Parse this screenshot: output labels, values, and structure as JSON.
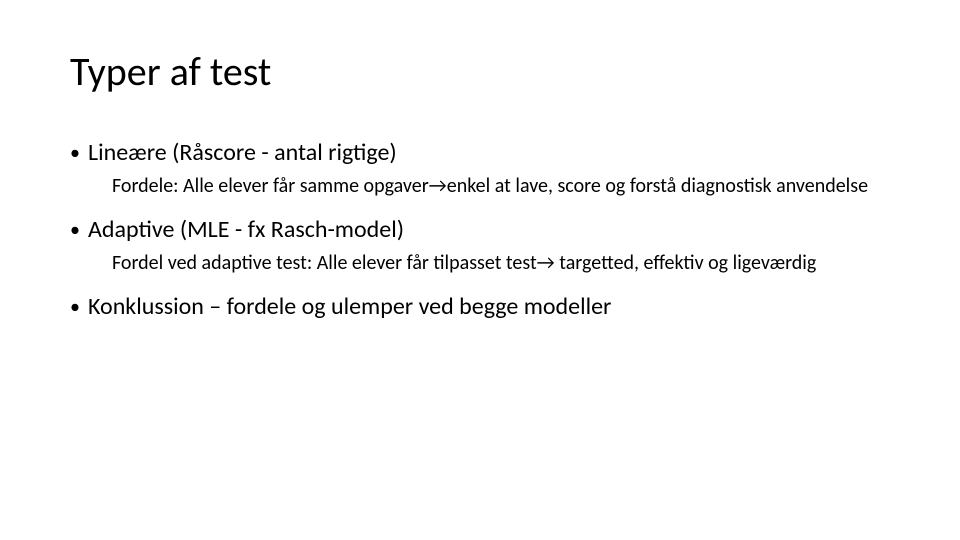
{
  "slide": {
    "title": "Typer af test",
    "bullets": [
      {
        "text": "Lineære (Råscore - antal rigtige)",
        "sub": "Fordele: Alle elever får samme opgaver→enkel at lave, score og forstå diagnostisk anvendelse"
      },
      {
        "text": "Adaptive (MLE - fx Rasch-model)",
        "sub": "Fordel ved adaptive test: Alle elever får tilpasset test→ targetted, effektiv og ligeværdig"
      },
      {
        "text": "Konklussion – fordele og ulemper ved begge modeller",
        "sub": null
      }
    ]
  }
}
